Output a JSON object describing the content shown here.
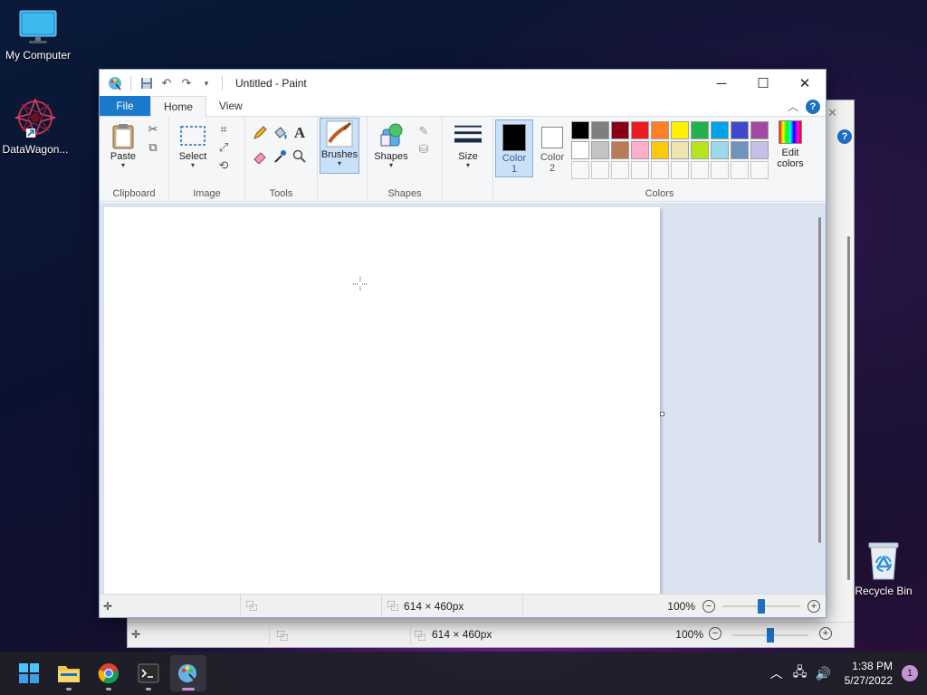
{
  "desktop": {
    "icons": [
      {
        "label": "My Computer"
      },
      {
        "label": "DataWagon..."
      },
      {
        "label": "Recycle Bin"
      }
    ]
  },
  "window": {
    "title": "Untitled - Paint",
    "controls": {
      "minimize": "─",
      "maximize": "☐",
      "close": "✕"
    }
  },
  "ribbon": {
    "tabs": [
      "File",
      "Home",
      "View"
    ],
    "active_tab": "Home",
    "groups": {
      "clipboard": {
        "label": "Clipboard",
        "paste": "Paste"
      },
      "image": {
        "label": "Image",
        "select": "Select"
      },
      "tools": {
        "label": "Tools",
        "text_tool": "A"
      },
      "brushes": {
        "label": "Brushes"
      },
      "shapes": {
        "label": "Shapes",
        "shapes": "Shapes"
      },
      "size": {
        "label": "Size"
      },
      "colors": {
        "label": "Colors",
        "color1": "Color\n1",
        "color2": "Color\n2",
        "color1_line1": "Color",
        "color1_line2": "1",
        "color2_line1": "Color",
        "color2_line2": "2",
        "edit_line1": "Edit",
        "edit_line2": "colors",
        "color1_value": "#000000",
        "color2_value": "#ffffff",
        "palette_row1": [
          "#000000",
          "#7f7f7f",
          "#880015",
          "#ed1c24",
          "#ff7f27",
          "#fff200",
          "#22b14c",
          "#00a2e8",
          "#3f48cc",
          "#a349a4"
        ],
        "palette_row2": [
          "#ffffff",
          "#c3c3c3",
          "#b97a57",
          "#ffaec9",
          "#ffc90e",
          "#efe4b0",
          "#b5e61d",
          "#99d9ea",
          "#7092be",
          "#c8bfe7"
        ]
      }
    }
  },
  "status": {
    "selection_size": "",
    "canvas_size": "614 × 460px",
    "zoom": "100%",
    "zoom_slider_fraction": 0.5
  },
  "background_window": {
    "canvas_size": "614 × 460px",
    "zoom": "100%"
  },
  "taskbar": {
    "time": "1:38 PM",
    "date": "5/27/2022",
    "notification_count": "1"
  }
}
